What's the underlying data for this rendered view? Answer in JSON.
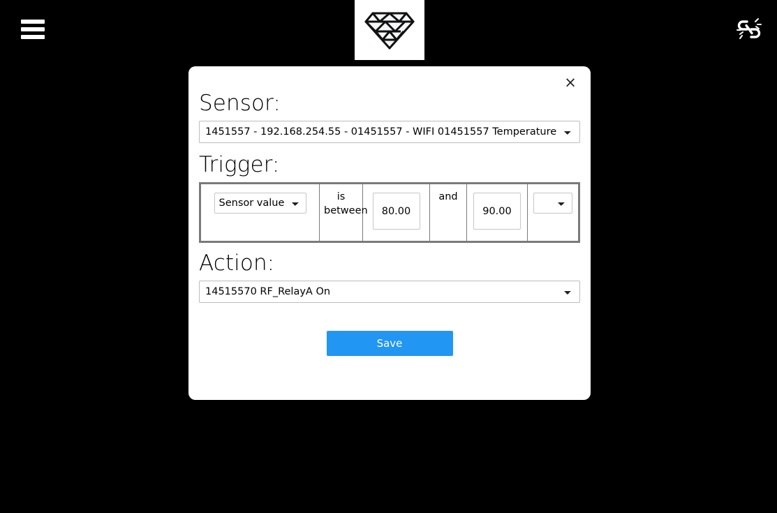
{
  "topbar": {
    "menu_icon": "hamburger-menu-icon",
    "logo_icon": "diamond-logo-icon",
    "status_icon": "broken-link-icon",
    "logo_background": "#ffffff",
    "background": "#000000"
  },
  "modal": {
    "close_label": "×",
    "sections": {
      "sensor": {
        "title": "Sensor:",
        "selected": "1451557 - 192.168.254.55 - 01451557 - WIFI 01451557 Temperature",
        "options": [
          "1451557 - 192.168.254.55 - 01451557 - WIFI 01451557 Temperature"
        ]
      },
      "trigger": {
        "title": "Trigger:",
        "source_selected": "Sensor value",
        "source_options": [
          "Sensor value"
        ],
        "condition_label": "is between",
        "value_low": "80.00",
        "value_high": "90.00",
        "conjunction_label": "and",
        "unit_selected": "",
        "unit_options": [
          ""
        ]
      },
      "action": {
        "title": "Action:",
        "selected": "14515570 RF_RelayA On",
        "options": [
          "14515570 RF_RelayA On"
        ]
      }
    },
    "save_label": "Save",
    "save_color": "#2196f3"
  }
}
